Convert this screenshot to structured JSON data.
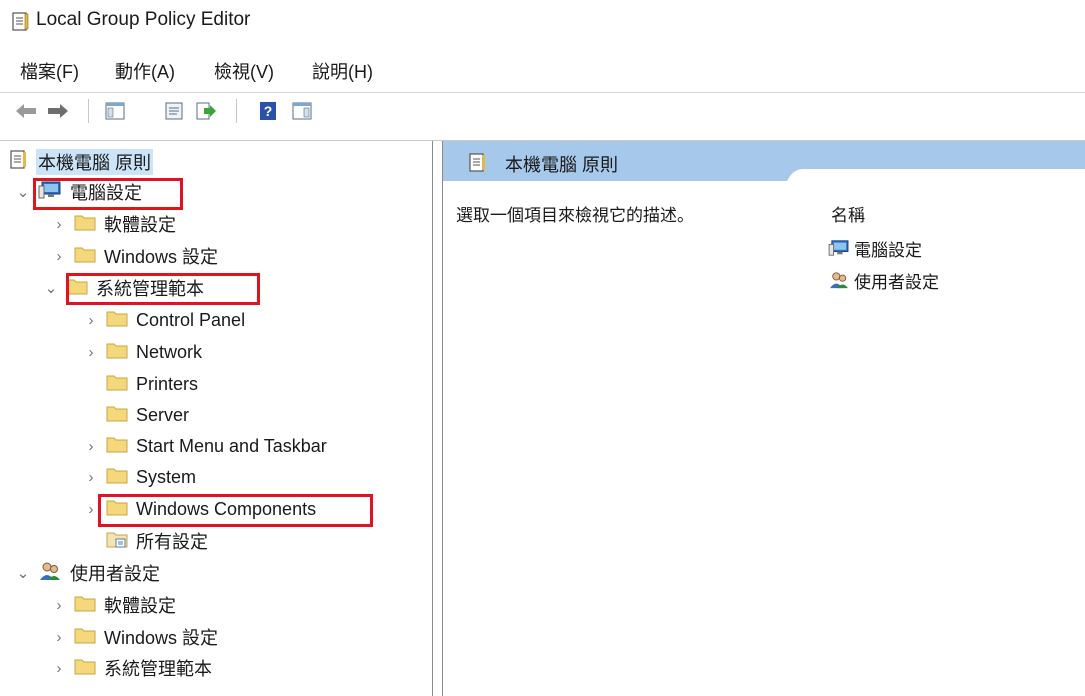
{
  "window": {
    "title": "Local Group Policy Editor"
  },
  "menu": [
    "檔案(F)",
    "動作(A)",
    "檢視(V)",
    "說明(H)"
  ],
  "toolbar": {
    "buttons": [
      "back-icon",
      "forward-icon",
      "show-hide-tree-icon",
      "properties-icon",
      "export-list-icon",
      "help-icon",
      "action-pane-icon"
    ]
  },
  "tree": {
    "root": "本機電腦 原則",
    "computer_config": "電腦設定",
    "comp_software": "軟體設定",
    "comp_windows": "Windows 設定",
    "comp_admin": "系統管理範本",
    "control_panel": "Control Panel",
    "network": "Network",
    "printers": "Printers",
    "server": "Server",
    "start_menu": "Start Menu and Taskbar",
    "system": "System",
    "windows_components": "Windows Components",
    "all_settings": "所有設定",
    "user_config": "使用者設定",
    "user_software": "軟體設定",
    "user_windows": "Windows 設定",
    "user_admin": "系統管理範本"
  },
  "right": {
    "header": "本機電腦 原則",
    "description": "選取一個項目來檢視它的描述。",
    "column_name": "名稱",
    "items": [
      "電腦設定",
      "使用者設定"
    ]
  },
  "colors": {
    "highlight": "#e0141e",
    "header_blue": "#a6c8ea",
    "folder": "#f5d77c"
  }
}
